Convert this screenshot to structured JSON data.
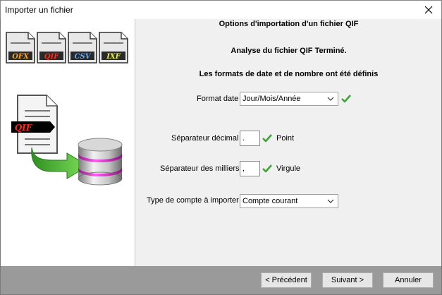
{
  "window": {
    "title": "Importer un fichier"
  },
  "illustration": {
    "formats": [
      "OFX",
      "QIF",
      "CSV",
      "IXF"
    ],
    "source_tag": "QIF"
  },
  "main": {
    "heading": "Options d'importation d'un fichier QIF",
    "status": "Analyse du fichier QIF Terminé.",
    "info": "Les formats de date et de nombre ont été définis"
  },
  "form": {
    "date_format": {
      "label": "Format date",
      "value": "Jour/Mois/Année"
    },
    "decimal_separator": {
      "label": "Séparateur décimal",
      "value": ".",
      "description": "Point"
    },
    "thousands_separator": {
      "label": "Séparateur des milliers",
      "value": ",",
      "description": "Virgule"
    },
    "account_type": {
      "label": "Type de compte à importer",
      "value": "Compte courant"
    }
  },
  "buttons": {
    "previous": "< Précédent",
    "next": "Suivant >",
    "cancel": "Annuler"
  },
  "colors": {
    "check": "#3fa535",
    "tag_bg": "#000000",
    "tag_text": "#ff2a1a",
    "bottom_bar": "#9a9a9a"
  },
  "icons": [
    "close-icon",
    "chevron-down-icon",
    "checkmark-icon",
    "document-icon",
    "database-icon",
    "arrow-icon"
  ]
}
